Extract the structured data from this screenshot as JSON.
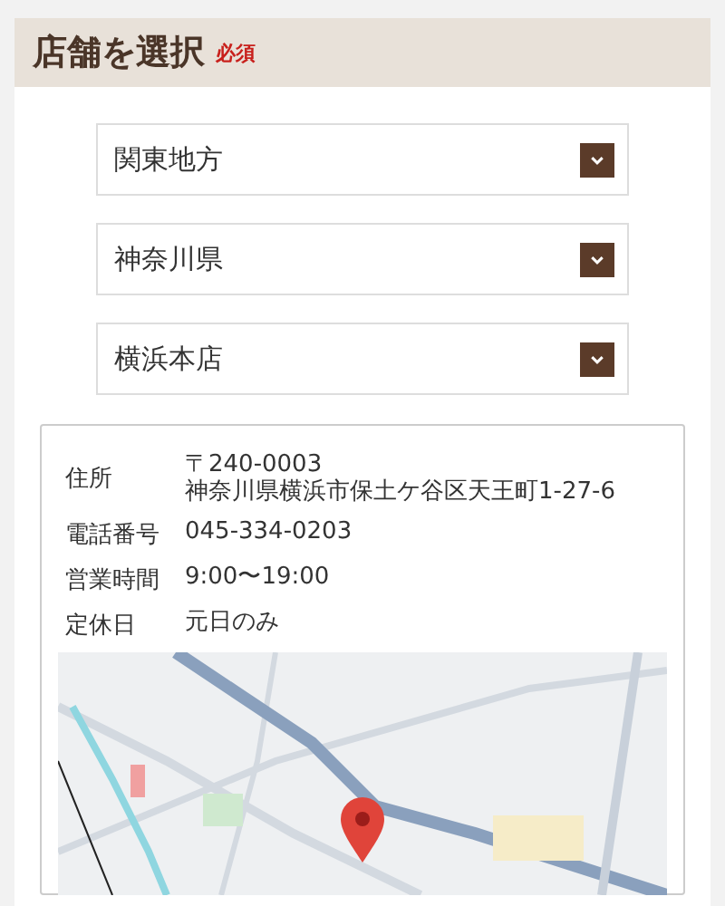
{
  "header": {
    "title": "店舗を選択",
    "required_badge": "必須"
  },
  "selects": [
    {
      "value": "関東地方"
    },
    {
      "value": "神奈川県"
    },
    {
      "value": "横浜本店"
    }
  ],
  "store_info": {
    "rows": [
      {
        "label": "住所",
        "lines": [
          "〒240-0003",
          "神奈川県横浜市保土ケ谷区天王町1-27-6"
        ]
      },
      {
        "label": "電話番号",
        "lines": [
          "045-334-0203"
        ]
      },
      {
        "label": "営業時間",
        "lines": [
          "9:00〜19:00"
        ]
      },
      {
        "label": "定休日",
        "lines": [
          "元日のみ"
        ]
      }
    ]
  }
}
